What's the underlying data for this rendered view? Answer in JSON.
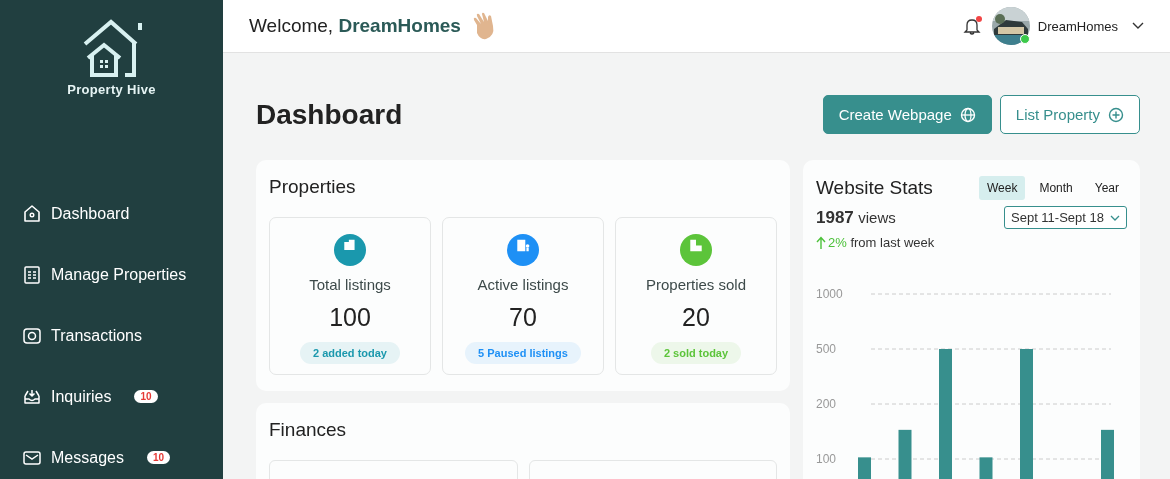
{
  "sidebar": {
    "brand": "Property Hive",
    "items": [
      {
        "label": "Dashboard",
        "selected": false
      },
      {
        "label": "Manage Properties",
        "selected": false
      },
      {
        "label": "Transactions",
        "selected": false
      },
      {
        "label": "Inquiries",
        "badge": "10",
        "selected": false
      },
      {
        "label": "Messages",
        "badge": "10",
        "selected": false
      }
    ]
  },
  "header": {
    "greeting": "Welcome,",
    "user": "DreamHomes",
    "unread_notifications": true,
    "profile": {
      "name": "DreamHomes",
      "online": true
    }
  },
  "page": {
    "title": "Dashboard",
    "actions": [
      {
        "label": "Create Webpage",
        "kind": "primary"
      },
      {
        "label": "List Property",
        "kind": "outline"
      }
    ]
  },
  "properties": {
    "title": "Properties",
    "stats": [
      {
        "label": "Total listings",
        "value": "100",
        "note": "2 added today",
        "color": "#1a98ad"
      },
      {
        "label": "Active listings",
        "value": "70",
        "note": "5 Paused listings",
        "color": "#1e90f5"
      },
      {
        "label": "Properties sold",
        "value": "20",
        "note": "2 sold today",
        "color": "#5cc43a"
      }
    ]
  },
  "finances": {
    "title": "Finances"
  },
  "website_stats": {
    "title": "Website Stats",
    "ranges": [
      {
        "label": "Week",
        "selected": true
      },
      {
        "label": "Month",
        "selected": false
      },
      {
        "label": "Year",
        "selected": false
      }
    ],
    "views": "1987",
    "views_label": "views",
    "change": "2%",
    "change_text": "from last week",
    "date_range": "Sept 11-Sept 18",
    "chart": {
      "axis_labels": [
        "1000",
        "500",
        "200",
        "100"
      ]
    }
  }
}
